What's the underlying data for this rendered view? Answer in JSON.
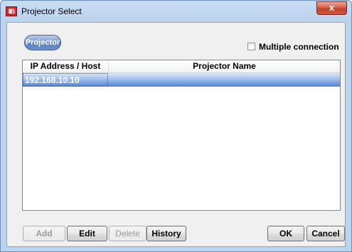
{
  "window": {
    "title": "Projector Select",
    "app_icon_text": "IIB",
    "close_glyph": "x"
  },
  "tab": {
    "label": "Projector"
  },
  "multiple_connection": {
    "label": "Multiple connection",
    "checked": false
  },
  "table": {
    "columns": [
      "IP Address / Host",
      "Projector Name"
    ],
    "rows": [
      {
        "ip": "192.168.10.10",
        "name": ""
      }
    ]
  },
  "buttons": {
    "add": "Add",
    "edit": "Edit",
    "delete": "Delete",
    "history": "History",
    "ok": "OK",
    "cancel": "Cancel"
  },
  "colors": {
    "selection": "#4d82d6",
    "title_bar": "#c9dcf1",
    "close_button": "#c2402c"
  }
}
